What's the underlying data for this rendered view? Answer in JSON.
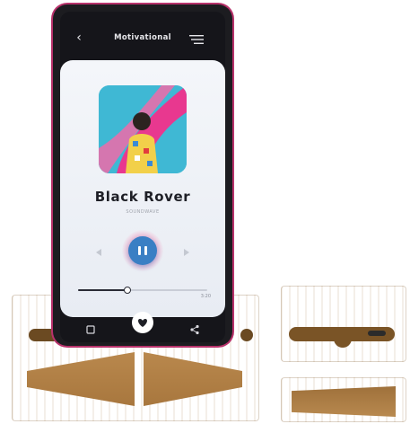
{
  "header": {
    "title": "Motivational"
  },
  "player": {
    "song_title": "Black Rover",
    "artist": "SOUNDWAVE",
    "duration": "3:20",
    "progress": 0.38,
    "state": "playing"
  },
  "bottom_bar": {
    "icons": [
      "playlist-icon",
      "heart-icon",
      "share-icon"
    ]
  },
  "colors": {
    "accent": "#3a7fc4",
    "phone_frame": "#b8326b",
    "album_background": "#3fb8d4",
    "album_streak": "#e8388f",
    "bamboo": "#d6a766"
  }
}
